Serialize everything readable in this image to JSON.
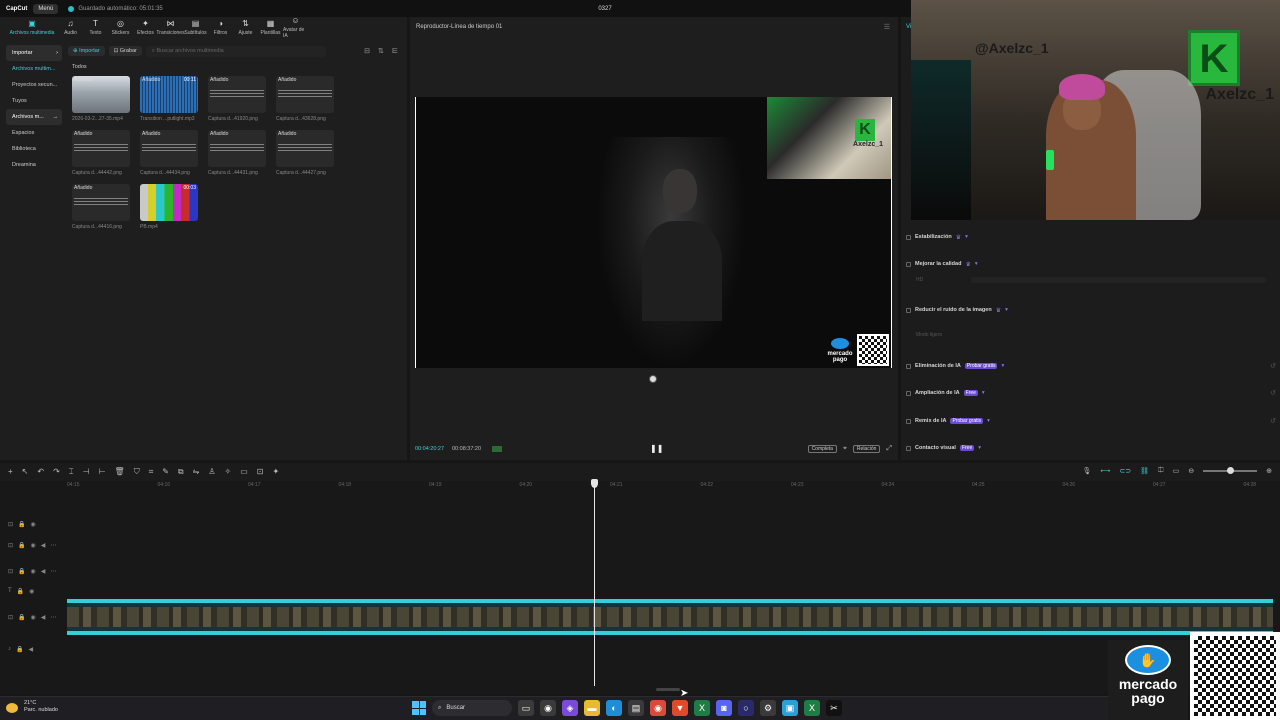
{
  "app": {
    "logo": "CapCut",
    "menu": "Menú",
    "autosave": "Guardado automático: 05:01:35",
    "project_title": "0327"
  },
  "toolbar": [
    {
      "label": "Archivos multimedia",
      "icon": "media-icon",
      "glyph": "▣"
    },
    {
      "label": "Audio",
      "icon": "audio-icon",
      "glyph": "♫"
    },
    {
      "label": "Texto",
      "icon": "text-icon",
      "glyph": "T"
    },
    {
      "label": "Stickers",
      "icon": "sticker-icon",
      "glyph": "◎"
    },
    {
      "label": "Efectos",
      "icon": "effects-icon",
      "glyph": "✦"
    },
    {
      "label": "Transiciones",
      "icon": "transition-icon",
      "glyph": "⋈"
    },
    {
      "label": "Subtítulos",
      "icon": "subtitles-icon",
      "glyph": "▤"
    },
    {
      "label": "Filtros",
      "icon": "filters-icon",
      "glyph": "◑"
    },
    {
      "label": "Ajuste",
      "icon": "adjust-icon",
      "glyph": "⇅"
    },
    {
      "label": "Plantillas",
      "icon": "templates-icon",
      "glyph": "▦"
    },
    {
      "label": "Avatar de IA",
      "icon": "ai-avatar-icon",
      "glyph": "☺"
    }
  ],
  "sidebar": {
    "items": [
      {
        "label": "Importar",
        "state": "selected"
      },
      {
        "label": "Archivos multim...",
        "state": "highlight"
      },
      {
        "label": "Proyectos secun...",
        "state": ""
      },
      {
        "label": "Tuyos",
        "state": ""
      },
      {
        "label": "Archivos m...",
        "state": "selected"
      },
      {
        "label": "Espacios",
        "state": ""
      },
      {
        "label": "Biblioteca",
        "state": ""
      },
      {
        "label": "Dreamina",
        "state": ""
      }
    ]
  },
  "media": {
    "import_label": "Importar",
    "record_label": "Grabar",
    "search_placeholder": "Buscar archivos multimedia",
    "all_label": "Todos",
    "items": [
      {
        "tag": "Añadido",
        "name": "2026-03-2...27-35.mp4",
        "style": "photo",
        "duration": ""
      },
      {
        "tag": "Añadido",
        "name": "Transition ...putlight.mp3",
        "style": "wave",
        "duration": "00:11"
      },
      {
        "tag": "Añadido",
        "name": "Captura d...41920.png",
        "style": "text",
        "duration": ""
      },
      {
        "tag": "Añadido",
        "name": "Captura d...43628.png",
        "style": "text",
        "duration": ""
      },
      {
        "tag": "Añadido",
        "name": "Captura d...44442.png",
        "style": "text",
        "duration": ""
      },
      {
        "tag": "Añadido",
        "name": "Captura d...44434.png",
        "style": "text",
        "duration": ""
      },
      {
        "tag": "Añadido",
        "name": "Captura d...44431.png",
        "style": "text",
        "duration": ""
      },
      {
        "tag": "Añadido",
        "name": "Captura d...44427.png",
        "style": "text",
        "duration": ""
      },
      {
        "tag": "Añadido",
        "name": "Captura d...44416.png",
        "style": "text",
        "duration": ""
      },
      {
        "tag": "",
        "name": "PB.mp4",
        "style": "bars",
        "duration": "00:03"
      }
    ]
  },
  "player": {
    "title": "Reproductor-Línea de tiempo 01",
    "current_time": "00:04:20:27",
    "total_time": "00:08:37:20",
    "pip_name": "Axelzc_1",
    "mp_text": "mercado pago",
    "complete_label": "Completa",
    "ratio_label": "Relación"
  },
  "properties": {
    "tab": "Vi",
    "rows": [
      {
        "label": "Estabilización",
        "badge": "",
        "crown": "♛",
        "reset": false
      },
      {
        "label": "Mejorar la calidad",
        "badge": "",
        "crown": "♛",
        "reset": false
      },
      {
        "label": "Reducir el ruido de la imagen",
        "badge": "",
        "crown": "♛",
        "reset": false
      },
      {
        "label": "Eliminación de IA",
        "badge": "Probar gratis",
        "crown": "",
        "reset": true
      },
      {
        "label": "Ampliación de IA",
        "badge": "Free",
        "crown": "",
        "reset": true
      },
      {
        "label": "Remix de IA",
        "badge": "Probar gratis",
        "crown": "",
        "reset": true
      },
      {
        "label": "Contacto visual",
        "badge": "Free",
        "crown": "",
        "reset": false
      }
    ],
    "sub_labels": [
      "HD",
      "Modo ligero"
    ]
  },
  "webcam": {
    "handle": "@Axelzc_1",
    "wall_letter": "K",
    "wall_name": "Axelzc_1"
  },
  "timeline": {
    "ticks": [
      "04:15",
      "04:16",
      "04:17",
      "04:18",
      "04:19",
      "04:20",
      "04:21",
      "04:22",
      "04:23",
      "04:24",
      "04:25",
      "04:26",
      "04:27",
      "04:28"
    ]
  },
  "overlay": {
    "mp_line1": "mercado",
    "mp_line2": "pago"
  },
  "taskbar": {
    "temp": "21°C",
    "weather": "Parc. nublado",
    "search": "Buscar",
    "apps": [
      {
        "icon": "task-view-icon",
        "glyph": "▭",
        "color": "#3a3a3a"
      },
      {
        "icon": "chrome-icon",
        "glyph": "◉",
        "color": "#3a3a3a"
      },
      {
        "icon": "copilot-icon",
        "glyph": "◈",
        "color": "#7a4ad9"
      },
      {
        "icon": "folder-icon",
        "glyph": "▬",
        "color": "#e8b931"
      },
      {
        "icon": "edge-icon",
        "glyph": "◐",
        "color": "#1e8fd6"
      },
      {
        "icon": "store-icon",
        "glyph": "▤",
        "color": "#3a3a3a"
      },
      {
        "icon": "chrome-alt-icon",
        "glyph": "◉",
        "color": "#d94a3a"
      },
      {
        "icon": "brave-icon",
        "glyph": "▼",
        "color": "#e04a2a"
      },
      {
        "icon": "excel-icon",
        "glyph": "X",
        "color": "#1e7d45"
      },
      {
        "icon": "discord-icon",
        "glyph": "◙",
        "color": "#5865f2"
      },
      {
        "icon": "obs-icon",
        "glyph": "○",
        "color": "#2a2a6a"
      },
      {
        "icon": "settings-icon",
        "glyph": "⚙",
        "color": "#3a3a3a"
      },
      {
        "icon": "app-icon",
        "glyph": "▣",
        "color": "#2aa0d9"
      },
      {
        "icon": "xbox-icon",
        "glyph": "X",
        "color": "#1e7d45"
      },
      {
        "icon": "capcut-icon",
        "glyph": "✂",
        "color": "#111"
      }
    ]
  }
}
